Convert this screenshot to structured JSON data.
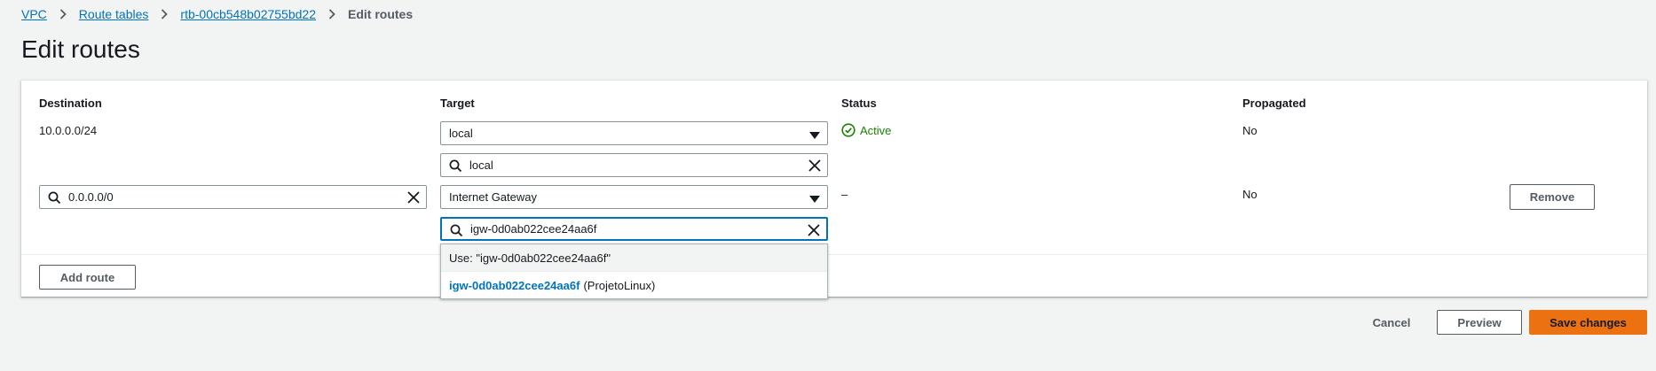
{
  "breadcrumb": {
    "items": [
      "VPC",
      "Route tables",
      "rtb-00cb548b02755bd22"
    ],
    "current": "Edit routes"
  },
  "page": {
    "title": "Edit routes"
  },
  "table": {
    "headers": {
      "destination": "Destination",
      "target": "Target",
      "status": "Status",
      "propagated": "Propagated"
    },
    "rows": [
      {
        "destination": "10.0.0.0/24",
        "target_select": "local",
        "target_search": "local",
        "status": "Active",
        "propagated": "No"
      },
      {
        "destination_search": "0.0.0.0/0",
        "target_select": "Internet Gateway",
        "target_search": "igw-0d0ab022cee24aa6f",
        "status": "–",
        "propagated": "No",
        "remove_label": "Remove"
      }
    ],
    "add_route_label": "Add route"
  },
  "dropdown": {
    "use_option": "Use: \"igw-0d0ab022cee24aa6f\"",
    "option_id": "igw-0d0ab022cee24aa6f",
    "option_name": "(ProjetoLinux)"
  },
  "footer": {
    "cancel": "Cancel",
    "preview": "Preview",
    "save": "Save changes"
  },
  "colors": {
    "link": "#0073bb",
    "success": "#1d8102",
    "primary": "#ec7211",
    "focus": "#0073bb"
  }
}
